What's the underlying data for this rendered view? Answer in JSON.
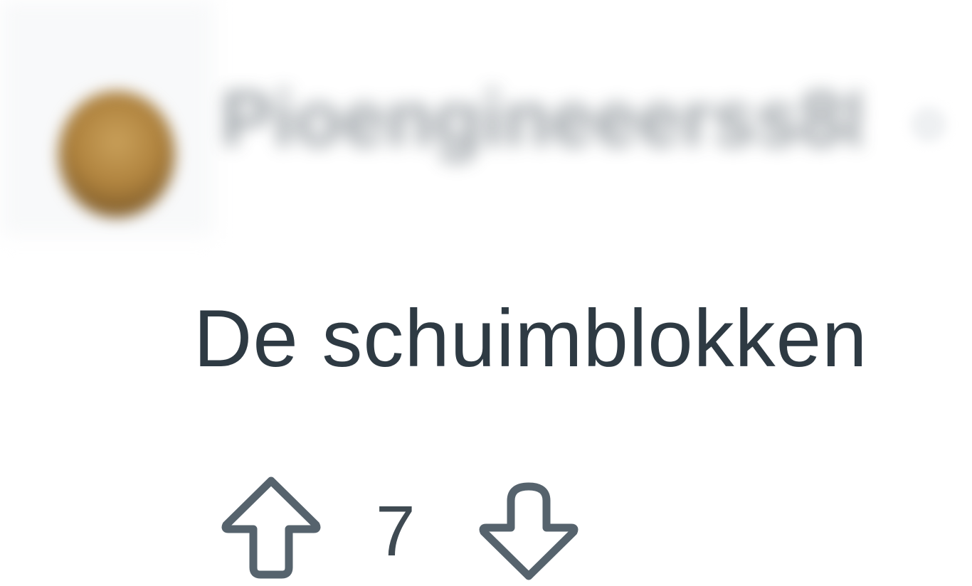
{
  "comment": {
    "author": {
      "username": "Pioengineeerss8800",
      "avatar_alt": "avatar"
    },
    "body_text": "De schuimblokken",
    "votes": {
      "count": "7",
      "upvote_icon": "arrow-up-outline",
      "downvote_icon": "arrow-down-outline"
    },
    "colors": {
      "text": "#2e3a43",
      "icon": "#56636d",
      "avatar": "#b0833e"
    }
  }
}
